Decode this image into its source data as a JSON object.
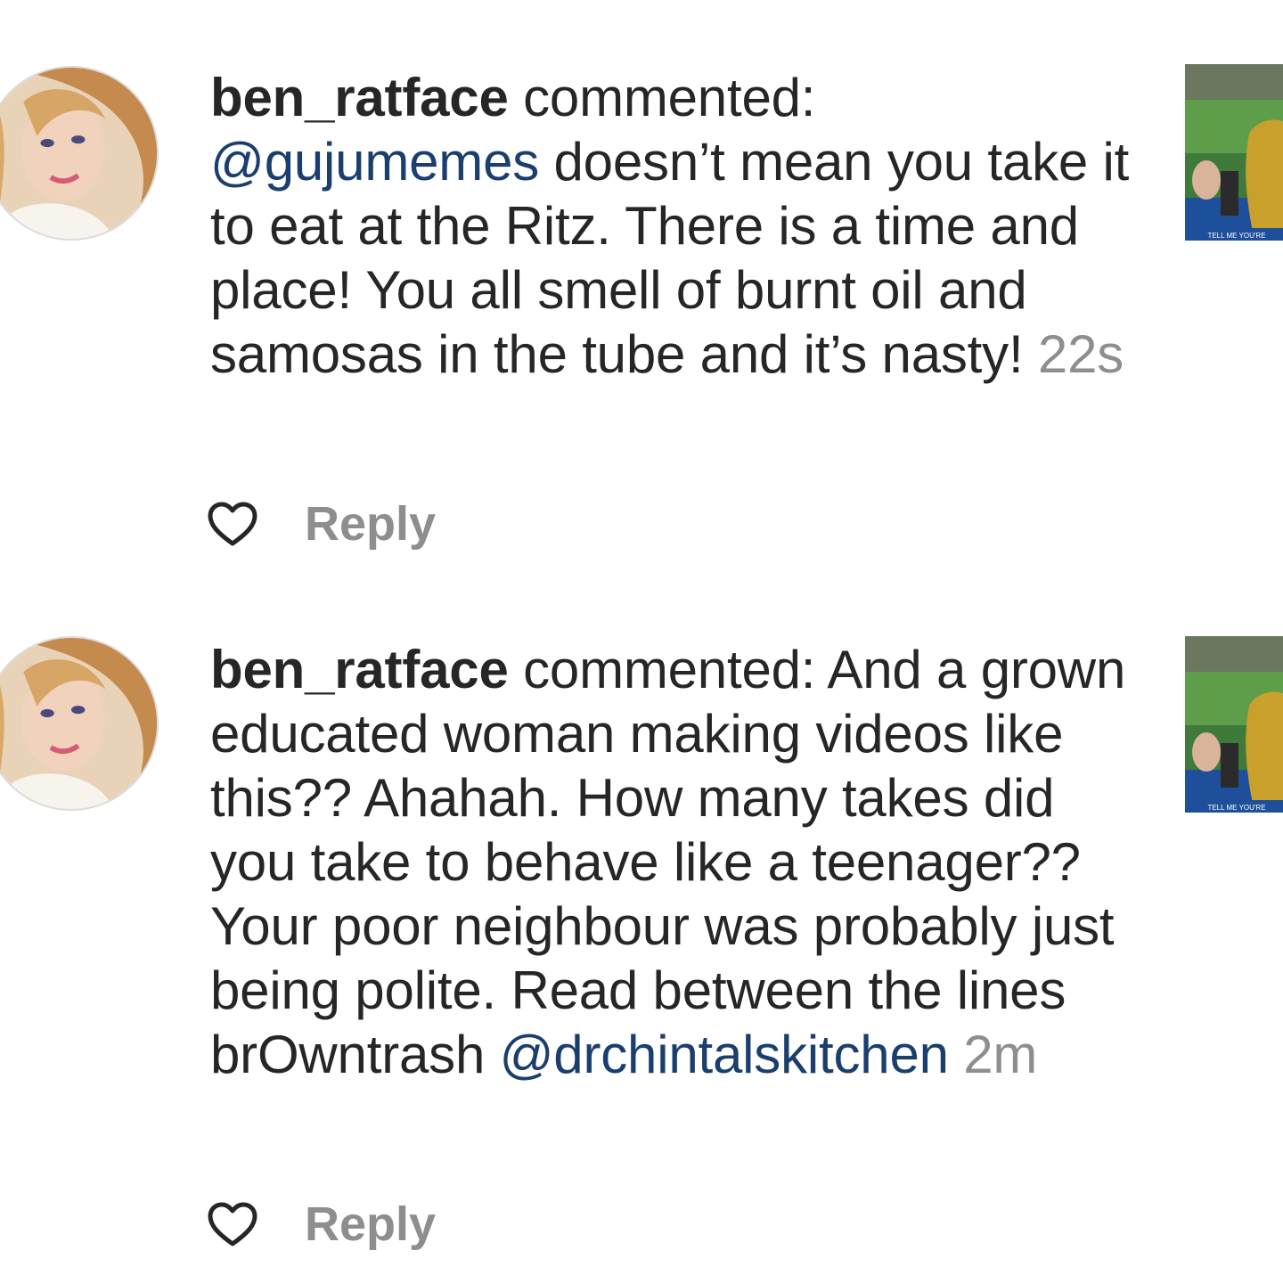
{
  "notifications": [
    {
      "username": "ben_ratface",
      "action": " commented: ",
      "mention_lead": "@gujumemes",
      "text": " doesn’t mean you take it to eat at the Ritz. There is a time and place! You all smell of burnt oil and samosas in the tube and it’s nasty!",
      "mention_tail": "",
      "timestamp": " 22s",
      "reply_label": "Reply",
      "like_icon": "heart-outline-icon",
      "thumbnail_caption": "TELL ME YOU'RE"
    },
    {
      "username": "ben_ratface",
      "action": " commented: ",
      "mention_lead": "",
      "text": "And a grown educated woman making videos like this?? Ahahah. How many takes did you take to behave like a teenager?? Your poor neighbour was probably just being polite. Read between the lines brOwntrash ",
      "mention_tail": "@drchintalskitchen",
      "timestamp": " 2m",
      "reply_label": "Reply",
      "like_icon": "heart-outline-icon",
      "thumbnail_caption": "TELL ME YOU'RE"
    }
  ],
  "colors": {
    "text": "#262626",
    "mention": "#1a3e6e",
    "muted": "#8e8e8e",
    "background": "#ffffff"
  }
}
